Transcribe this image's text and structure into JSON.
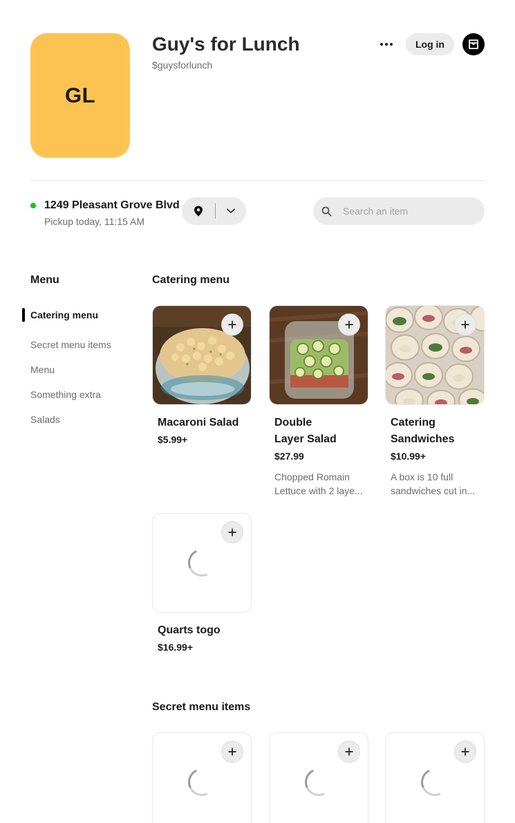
{
  "store": {
    "avatar_initials": "GL",
    "avatar_color": "#fdc352",
    "name": "Guy's for Lunch",
    "handle": "$guysforlunch"
  },
  "header": {
    "login_label": "Log in"
  },
  "location": {
    "address": "1249 Pleasant Grove Blvd",
    "pickup": "Pickup today, 11:15 AM",
    "status_color": "#16c21f"
  },
  "search": {
    "placeholder": "Search an item"
  },
  "sidebar": {
    "title": "Menu",
    "items": [
      {
        "label": "Catering menu",
        "active": true
      },
      {
        "label": "Secret menu items"
      },
      {
        "label": "Menu"
      },
      {
        "label": "Something extra"
      },
      {
        "label": "Salads"
      }
    ]
  },
  "sections": [
    {
      "title": "Catering menu",
      "items": [
        {
          "name": "Macaroni Salad",
          "price": "$5.99+",
          "description": "",
          "image": "macaroni-salad-photo"
        },
        {
          "name": "Double Layer Salad",
          "price": "$27.99",
          "description": "Chopped Romain Lettuce with 2 laye...",
          "image": "layer-salad-photo"
        },
        {
          "name": "Catering Sandwiches",
          "price": "$10.99+",
          "description": "A box is 10 full sandwiches cut in...",
          "image": "sandwiches-photo"
        },
        {
          "name": "Quarts togo",
          "price": "$16.99+",
          "description": "",
          "image": "loading"
        }
      ]
    },
    {
      "title": "Secret menu items",
      "items": [
        {
          "image": "loading"
        },
        {
          "image": "loading"
        },
        {
          "image": "loading"
        }
      ]
    }
  ]
}
